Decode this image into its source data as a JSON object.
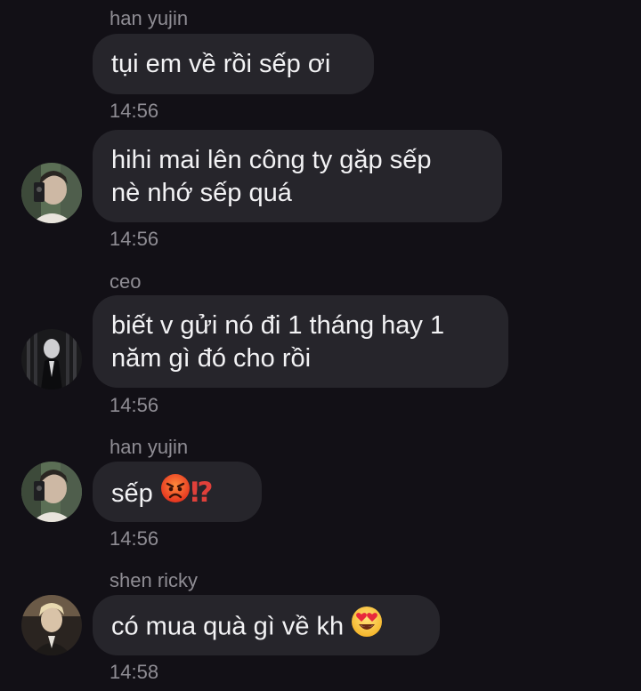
{
  "messages": [
    {
      "sender": "han yujin",
      "text": "tụi em về rồi sếp ơi",
      "time": "14:56"
    },
    {
      "sender": "",
      "text": "hihi mai lên công ty gặp sếp\nnè nhớ sếp quá",
      "time": "14:56"
    },
    {
      "sender": "ceo",
      "text": "biết v gửi nó đi 1 tháng hay 1\nnăm gì đó cho rồi",
      "time": "14:56"
    },
    {
      "sender": "han yujin",
      "text": "sếp",
      "emoji": "angry-face-emoji",
      "suffix": "⁉",
      "time": "14:56"
    },
    {
      "sender": "shen ricky",
      "text": "có mua quà gì về kh",
      "emoji": "heart-eyes-emoji",
      "time": "14:58"
    }
  ],
  "colors": {
    "background": "#121016",
    "bubble": "#26252b",
    "text": "#f2f2f4",
    "meta": "#8f8d94"
  }
}
